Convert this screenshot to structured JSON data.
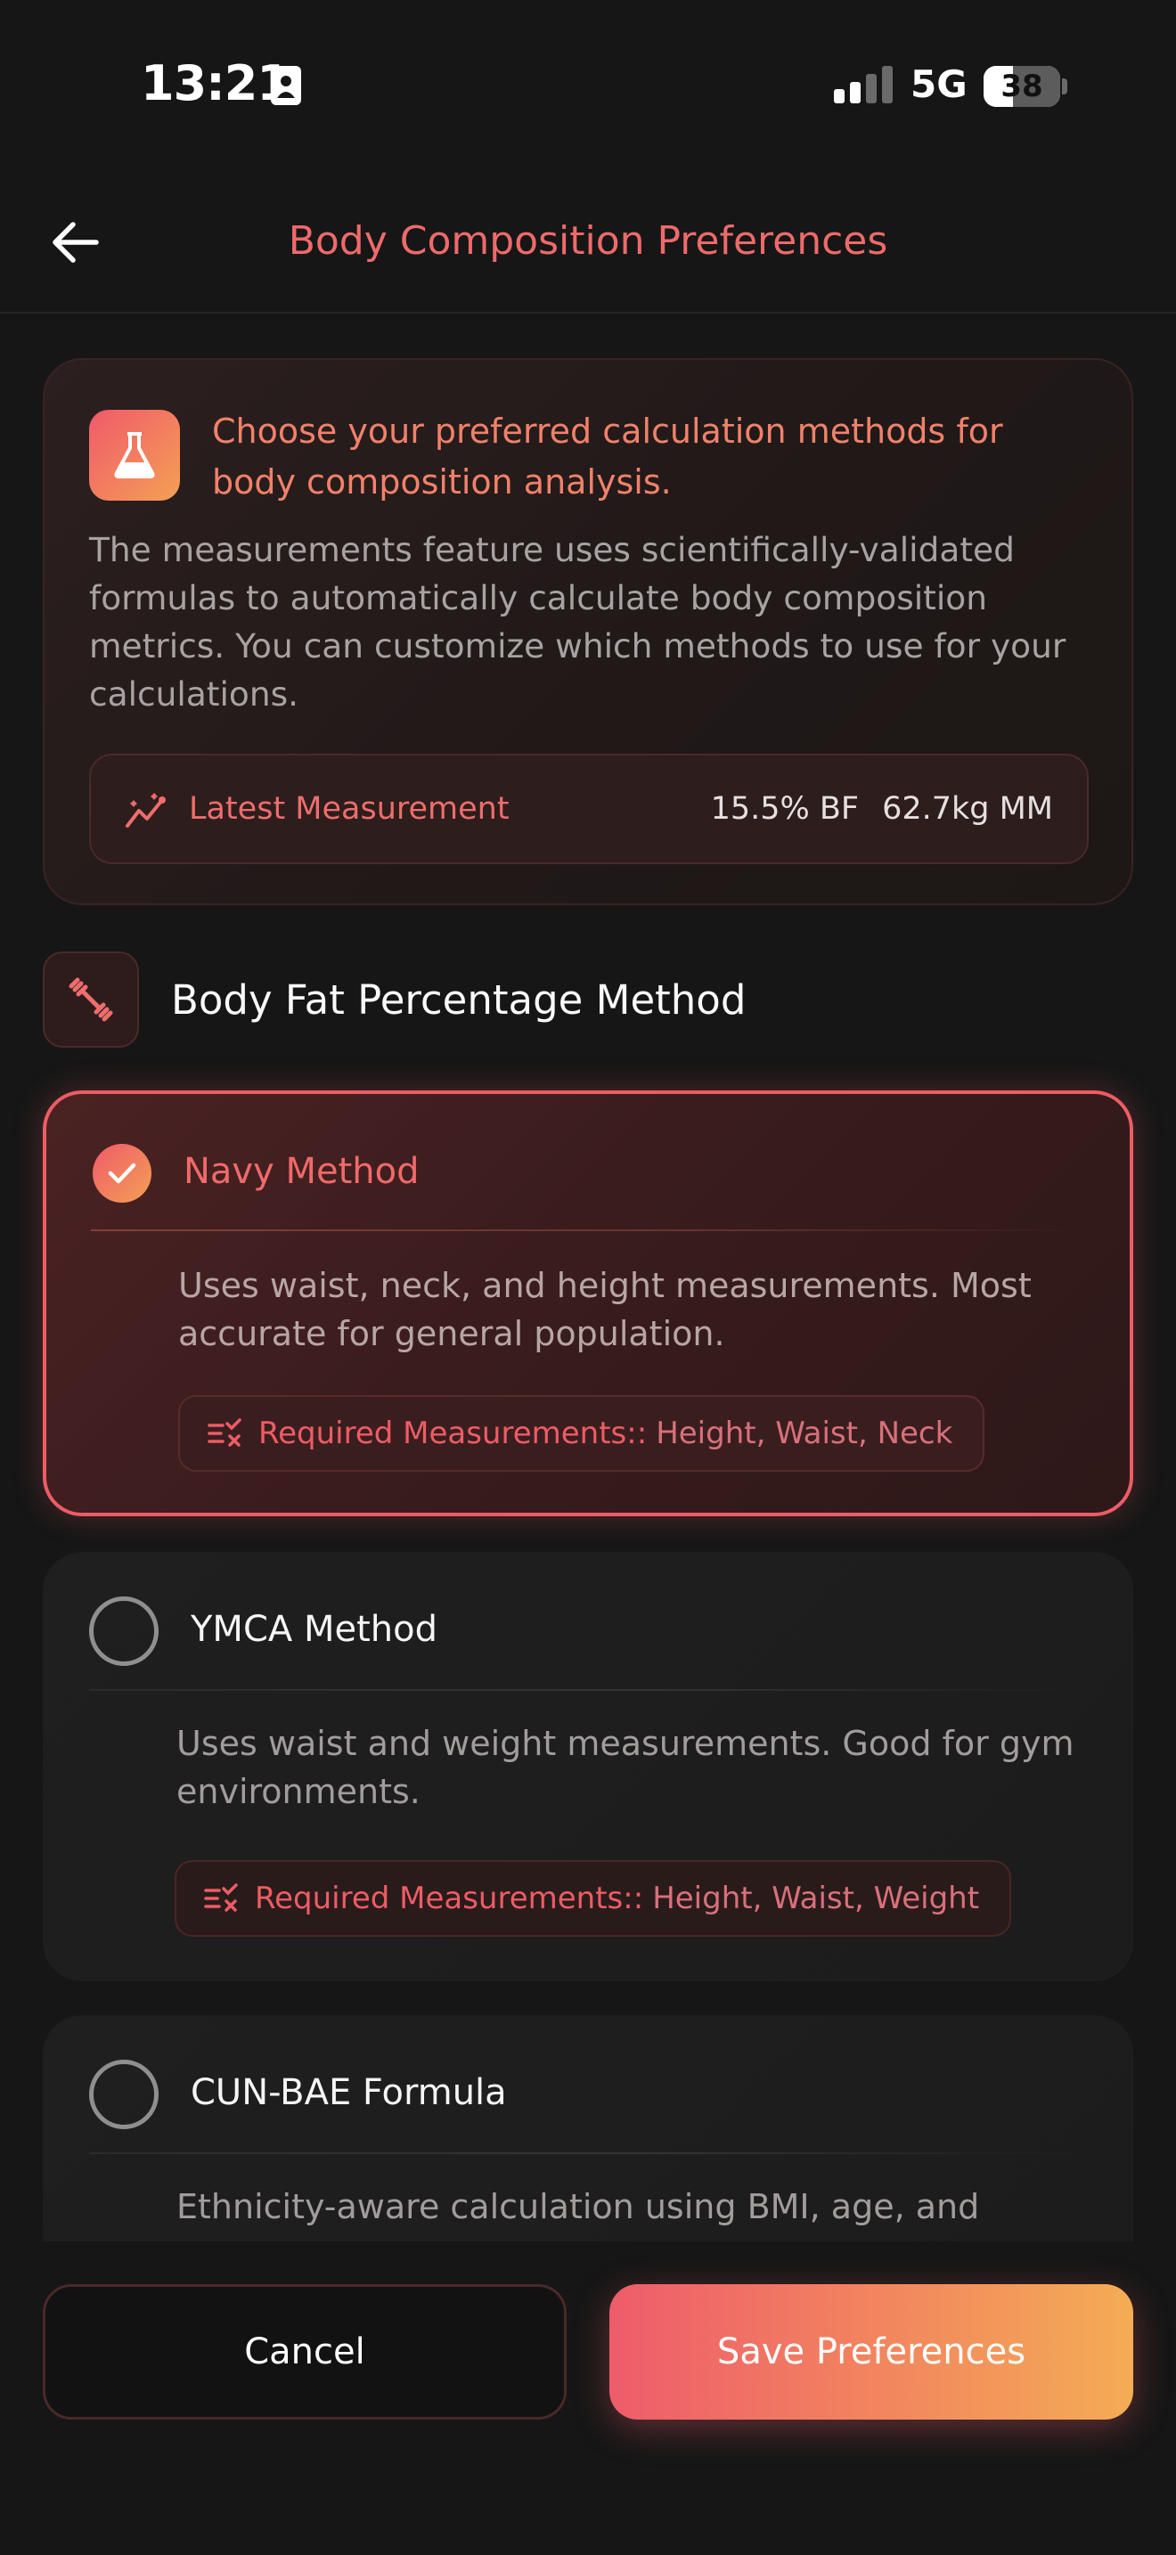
{
  "status_bar": {
    "time": "13:21",
    "network": "5G",
    "battery_level": "38",
    "battery_fraction": 0.38
  },
  "header": {
    "title": "Body Composition Preferences",
    "back_icon": "arrow-left-icon"
  },
  "info_card": {
    "icon": "flask-icon",
    "headline": "Choose your preferred calculation methods for body composition analysis.",
    "body": "The measurements feature uses scientifically-validated formulas to automatically calculate body composition metrics. You can customize which methods to use for your calculations.",
    "latest": {
      "icon": "trend-chart-icon",
      "label": "Latest Measurement",
      "body_fat": "15.5% BF",
      "muscle_mass": "62.7kg MM"
    }
  },
  "section": {
    "icon": "dumbbell-icon",
    "title": "Body Fat Percentage Method"
  },
  "methods": [
    {
      "name": "Navy Method",
      "selected": true,
      "description": "Uses waist, neck, and height measurements. Most accurate for general population.",
      "required_label": "Required Measurements::",
      "required_values": "Height, Waist, Neck"
    },
    {
      "name": "YMCA Method",
      "selected": false,
      "description": "Uses waist and weight measurements. Good for gym environments.",
      "required_label": "Required Measurements::",
      "required_values": "Height, Waist, Weight"
    },
    {
      "name": "CUN-BAE Formula",
      "selected": false,
      "description": "Ethnicity-aware calculation using BMI, age, and"
    }
  ],
  "actions": {
    "cancel_label": "Cancel",
    "save_label": "Save Preferences"
  },
  "colors": {
    "accent": "#ee5c65",
    "accent_orange": "#f4a055",
    "background": "#161616"
  }
}
